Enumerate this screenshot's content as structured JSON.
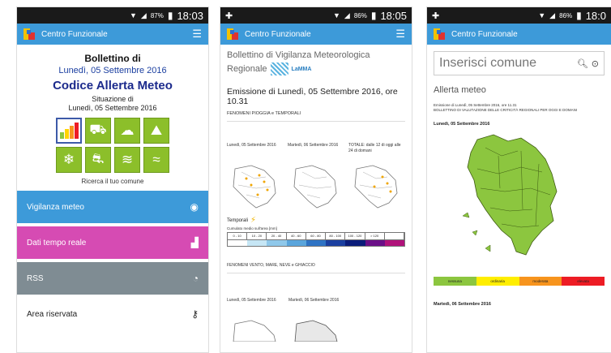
{
  "status": {
    "phone1": {
      "battery": "87%",
      "time": "18:03"
    },
    "phone2": {
      "battery": "86%",
      "time": "18:05"
    },
    "phone3": {
      "battery": "86%",
      "time": "18:0"
    }
  },
  "app": {
    "title": "Centro Funzionale"
  },
  "screen1": {
    "line1": "Bollettino di",
    "line2": "Lunedì, 05 Settembre 2016",
    "line3": "Codice Allerta Meteo",
    "line4": "Situazione di",
    "line5": "Lunedì, 05 Settembre 2016",
    "tiles": [
      "bar-chart-icon",
      "flood-car-icon",
      "storm-icon",
      "landslide-icon",
      "snowflake-icon",
      "ice-road-icon",
      "wind-icon",
      "waves-icon"
    ],
    "search_town": "Ricerca il tuo comune",
    "menu": [
      {
        "label": "Vigilanza meteo",
        "icon": "eye-icon"
      },
      {
        "label": "Dati tempo reale",
        "icon": "chart-icon"
      },
      {
        "label": "RSS",
        "icon": "rss-icon"
      },
      {
        "label": "Area riservata",
        "icon": "key-icon"
      }
    ],
    "colors": {
      "blue": "#3d9ad9",
      "pink": "#d64bb3",
      "gray": "#7f8c93",
      "green": "#8cbf2a"
    }
  },
  "screen2": {
    "heading": "Bollettino di Vigilanza Meteorologica",
    "heading2": "Regionale",
    "lamma": "LaMMA",
    "emission": "Emissione di Lunedì, 05 Settembre 2016, ore 10.31",
    "fenomeni1": "FENOMENI PIOGGIA e TEMPORALI",
    "map_captions": [
      "Lunedì, 05 Settembre 2016",
      "Martedì, 06 Settembre 2016",
      "TOTALE: dalle 12 di oggi alle 24 di domani"
    ],
    "temporali": "Temporali",
    "cumulato": "Cumulato medio sull'area [mm]",
    "legend": [
      "0 - 10",
      "10 - 20",
      "20 - 40",
      "40 - 60",
      "60 - 80",
      "80 - 100",
      "100 - 120",
      "> 120",
      ""
    ],
    "legend_colors": [
      "#ffffff",
      "#c6e6f5",
      "#8fc8ea",
      "#5aa5dc",
      "#2f73c4",
      "#1b3fa0",
      "#0b1c7a",
      "#6a0f87",
      "#b0127a"
    ],
    "fenomeni2": "FENOMENI VENTO, MARE, NEVE e GHIACCIO",
    "map_captions2": [
      "Lunedì, 05 Settembre 2016",
      "Martedì, 06 Settembre 2016"
    ]
  },
  "screen3": {
    "search_placeholder": "Inserisci comune",
    "allerta": "Allerta meteo",
    "emission": "Emissione di Lunedì, 05 Settembre 2016, ore 11.31",
    "bulletin": "BOLLETTINO DI VALUTAZIONE DELLE CRITICITÀ REGIONALI PER OGGI E DOMANI",
    "date1": "Lunedì, 05 Settembre 2016",
    "levels": [
      {
        "label": "nessuna",
        "color": "#8cc63f"
      },
      {
        "label": "ordinaria",
        "color": "#ffee00"
      },
      {
        "label": "moderata",
        "color": "#f7941d"
      },
      {
        "label": "elevata",
        "color": "#ed1c24"
      }
    ],
    "date2": "Martedì, 06 Settembre 2016"
  }
}
